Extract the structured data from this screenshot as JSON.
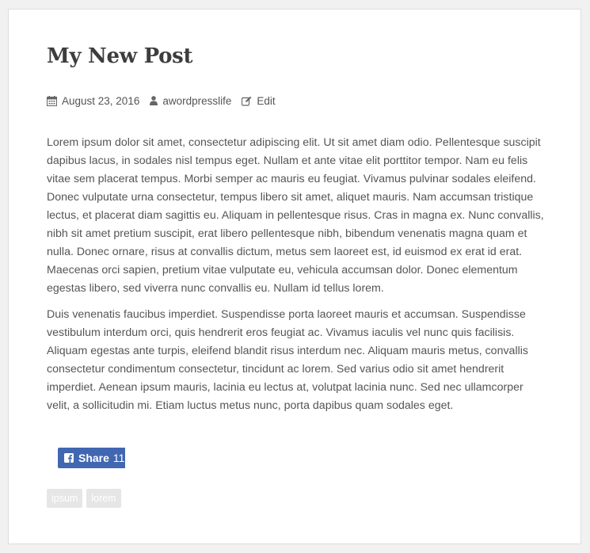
{
  "post": {
    "title": "My New Post",
    "meta": {
      "date": "August 23, 2016",
      "author": "awordpresslife",
      "edit_label": "Edit"
    },
    "paragraphs": [
      "Lorem ipsum dolor sit amet, consectetur adipiscing elit. Ut sit amet diam odio. Pellentesque suscipit dapibus lacus, in sodales nisl tempus eget. Nullam et ante vitae elit porttitor tempor. Nam eu felis vitae sem placerat tempus. Morbi semper ac mauris eu feugiat. Vivamus pulvinar sodales eleifend. Donec vulputate urna consectetur, tempus libero sit amet, aliquet mauris. Nam accumsan tristique lectus, et placerat diam sagittis eu. Aliquam in pellentesque risus. Cras in magna ex. Nunc convallis, nibh sit amet pretium suscipit, erat libero pellentesque nibh, bibendum venenatis magna quam et nulla. Donec ornare, risus at convallis dictum, metus sem laoreet est, id euismod ex erat id erat. Maecenas orci sapien, pretium vitae vulputate eu, vehicula accumsan dolor. Donec elementum egestas libero, sed viverra nunc convallis eu. Nullam id tellus lorem.",
      "Duis venenatis faucibus imperdiet. Suspendisse porta laoreet mauris et accumsan. Suspendisse vestibulum interdum orci, quis hendrerit eros feugiat ac. Vivamus iaculis vel nunc quis facilisis. Aliquam egestas ante turpis, eleifend blandit risus interdum nec. Aliquam mauris metus, convallis consectetur condimentum consectetur, tincidunt ac lorem. Sed varius odio sit amet hendrerit imperdiet. Aenean ipsum mauris, lacinia eu lectus at, volutpat lacinia nunc. Sed nec ullamcorper velit, a sollicitudin mi. Etiam luctus metus nunc, porta dapibus quam sodales eget."
    ],
    "share": {
      "label": "Share",
      "count": "11",
      "icon": "facebook-icon",
      "color": "#4267b2"
    },
    "tags": [
      "ipsum",
      "lorem"
    ]
  }
}
